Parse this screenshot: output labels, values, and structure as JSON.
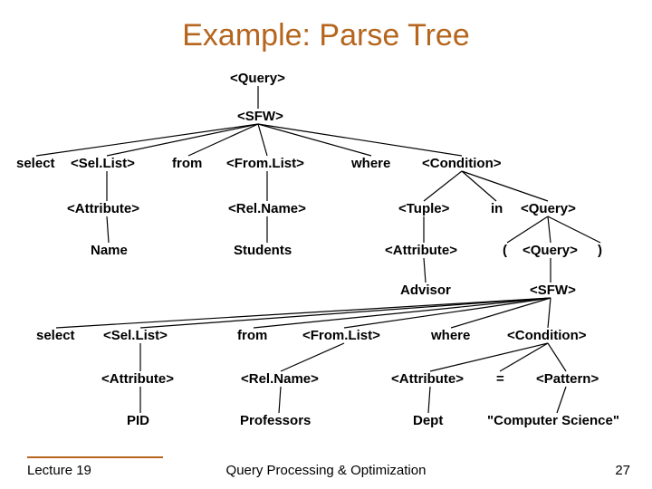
{
  "title": "Example: Parse Tree",
  "footer": {
    "left": "Lecture 19",
    "center": "Query Processing & Optimization",
    "right": "27"
  },
  "nodes": {
    "query": "<Query>",
    "sfw": "<SFW>",
    "select1": "select",
    "sellist1": "<Sel.List>",
    "from1": "from",
    "fromlist1": "<From.List>",
    "where1": "where",
    "condition1": "<Condition>",
    "attribute1": "<Attribute>",
    "relname1": "<Rel.Name>",
    "tuple": "<Tuple>",
    "in": "in",
    "query2": "<Query>",
    "name": "Name",
    "students": "Students",
    "attribute2": "<Attribute>",
    "lparen": "(",
    "query3": "<Query>",
    "rparen": ")",
    "advisor": "Advisor",
    "sfw2": "<SFW>",
    "select2": "select",
    "sellist2": "<Sel.List>",
    "from2": "from",
    "fromlist2": "<From.List>",
    "where2": "where",
    "condition2": "<Condition>",
    "attribute3": "<Attribute>",
    "relname2": "<Rel.Name>",
    "attribute4": "<Attribute>",
    "eq": "=",
    "pattern": "<Pattern>",
    "pid": "PID",
    "professors": "Professors",
    "dept": "Dept",
    "cs": "\"Computer Science\""
  },
  "chart_data": {
    "type": "tree",
    "title": "Example: Parse Tree",
    "root": "<Query>",
    "edges": [
      [
        "<Query>",
        "<SFW>"
      ],
      [
        "<SFW>",
        "select"
      ],
      [
        "<SFW>",
        "<Sel.List>#1"
      ],
      [
        "<SFW>",
        "from#1"
      ],
      [
        "<SFW>",
        "<From.List>#1"
      ],
      [
        "<SFW>",
        "where#1"
      ],
      [
        "<SFW>",
        "<Condition>#1"
      ],
      [
        "<Sel.List>#1",
        "<Attribute>#1"
      ],
      [
        "<Attribute>#1",
        "Name"
      ],
      [
        "<From.List>#1",
        "<Rel.Name>#1"
      ],
      [
        "<Rel.Name>#1",
        "Students"
      ],
      [
        "<Condition>#1",
        "<Tuple>"
      ],
      [
        "<Condition>#1",
        "in"
      ],
      [
        "<Condition>#1",
        "<Query>#2"
      ],
      [
        "<Tuple>",
        "<Attribute>#2"
      ],
      [
        "<Attribute>#2",
        "Advisor"
      ],
      [
        "<Query>#2",
        "("
      ],
      [
        "<Query>#2",
        "<Query>#3"
      ],
      [
        "<Query>#2",
        ")"
      ],
      [
        "<Query>#3",
        "<SFW>#2"
      ],
      [
        "<SFW>#2",
        "select#2"
      ],
      [
        "<SFW>#2",
        "<Sel.List>#2"
      ],
      [
        "<SFW>#2",
        "from#2"
      ],
      [
        "<SFW>#2",
        "<From.List>#2"
      ],
      [
        "<SFW>#2",
        "where#2"
      ],
      [
        "<SFW>#2",
        "<Condition>#2"
      ],
      [
        "<Sel.List>#2",
        "<Attribute>#3"
      ],
      [
        "<Attribute>#3",
        "PID"
      ],
      [
        "<From.List>#2",
        "<Rel.Name>#2"
      ],
      [
        "<Rel.Name>#2",
        "Professors"
      ],
      [
        "<Condition>#2",
        "<Attribute>#4"
      ],
      [
        "<Condition>#2",
        "="
      ],
      [
        "<Condition>#2",
        "<Pattern>"
      ],
      [
        "<Attribute>#4",
        "Dept"
      ],
      [
        "<Pattern>",
        "\"Computer Science\""
      ]
    ]
  }
}
